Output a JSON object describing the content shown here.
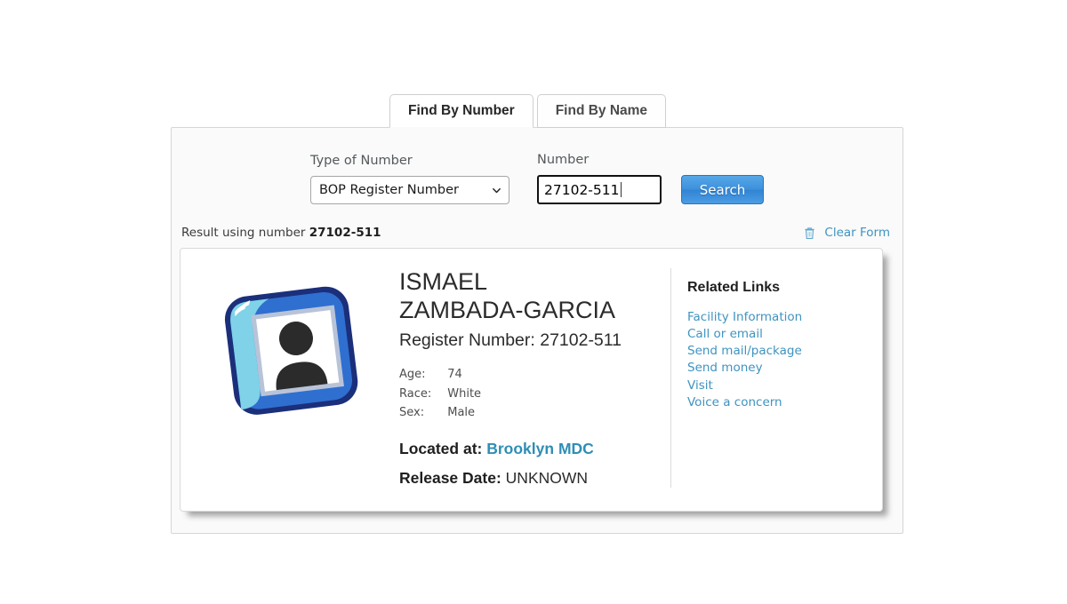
{
  "tabs": [
    {
      "label": "Find By Number",
      "active": true
    },
    {
      "label": "Find By Name",
      "active": false
    }
  ],
  "search_form": {
    "type_label": "Type of Number",
    "type_value": "BOP Register Number",
    "type_options": [
      "BOP Register Number"
    ],
    "number_label": "Number",
    "number_value": "27102-511",
    "number_placeholder": "",
    "search_button": "Search"
  },
  "result_bar": {
    "prefix": "Result using number ",
    "number": "27102-511",
    "clear_label": "Clear Form",
    "trash_icon": "trash-icon"
  },
  "inmate": {
    "photo_icon": "photo-placeholder-icon",
    "name": "ISMAEL ZAMBADA-GARCIA",
    "register_number_label": "Register Number: 27102-511",
    "attributes": [
      {
        "key": "Age:",
        "value": "74"
      },
      {
        "key": "Race:",
        "value": "White"
      },
      {
        "key": "Sex:",
        "value": "Male"
      }
    ],
    "located_label": "Located at:",
    "located_value": "Brooklyn MDC",
    "release_label": "Release Date:",
    "release_value": "UNKNOWN"
  },
  "related_links": {
    "title": "Related Links",
    "items": [
      "Facility Information",
      "Call or email",
      "Send mail/package",
      "Send money",
      "Visit",
      "Voice a concern"
    ]
  },
  "colors": {
    "link": "#3f93c0",
    "located_link": "#2f8eb5",
    "button": "#3d8fdb",
    "panel_bg": "#fafafa"
  }
}
